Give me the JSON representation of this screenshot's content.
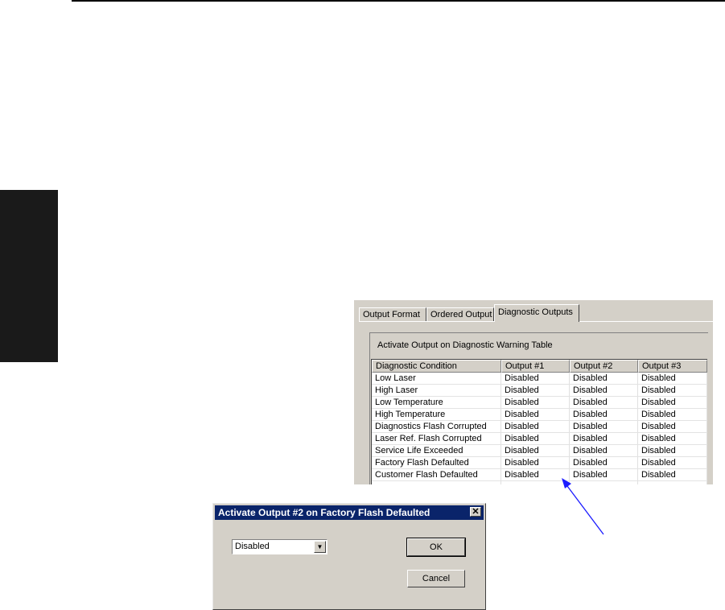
{
  "tabs": [
    "Output Format",
    "Ordered Output",
    "Diagnostic Outputs"
  ],
  "group_title": "Activate Output on Diagnostic Warning Table",
  "table": {
    "columns": [
      "Diagnostic Condition",
      "Output #1",
      "Output #2",
      "Output #3"
    ],
    "rows": [
      [
        "Low Laser",
        "Disabled",
        "Disabled",
        "Disabled"
      ],
      [
        "High Laser",
        "Disabled",
        "Disabled",
        "Disabled"
      ],
      [
        "Low Temperature",
        "Disabled",
        "Disabled",
        "Disabled"
      ],
      [
        "High Temperature",
        "Disabled",
        "Disabled",
        "Disabled"
      ],
      [
        "Diagnostics Flash Corrupted",
        "Disabled",
        "Disabled",
        "Disabled"
      ],
      [
        "Laser Ref. Flash Corrupted",
        "Disabled",
        "Disabled",
        "Disabled"
      ],
      [
        "Service Life Exceeded",
        "Disabled",
        "Disabled",
        "Disabled"
      ],
      [
        "Factory Flash Defaulted",
        "Disabled",
        "Disabled",
        "Disabled"
      ],
      [
        "Customer Flash Defaulted",
        "Disabled",
        "Disabled",
        "Disabled"
      ],
      [
        "",
        "",
        "",
        ""
      ]
    ]
  },
  "dialog": {
    "title": "Activate Output #2 on Factory Flash Defaulted",
    "select_value": "Disabled",
    "ok_label": "OK",
    "cancel_label": "Cancel",
    "close_symbol": "✕"
  },
  "arrow_color": "#1c1cff"
}
